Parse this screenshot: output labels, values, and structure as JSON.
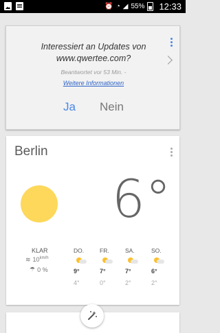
{
  "status_bar": {
    "battery": "55%",
    "time": "12:33"
  },
  "survey_card": {
    "question": "Interessiert an Updates von www.qwertee.com?",
    "meta": "Beantwortet vor 53 Min. -",
    "link": "Weitere Informationen",
    "yes_label": "Ja",
    "no_label": "Nein"
  },
  "weather_card": {
    "city": "Berlin",
    "temperature": "6°",
    "condition": "KLAR",
    "wind_value": "10",
    "wind_unit": "km/h",
    "precip": "0 %",
    "forecast": [
      {
        "day": "DO.",
        "high": "9°",
        "low": "4°"
      },
      {
        "day": "FR.",
        "high": "7°",
        "low": "0°"
      },
      {
        "day": "SA.",
        "high": "7°",
        "low": "2°"
      },
      {
        "day": "SO.",
        "high": "6°",
        "low": "2°"
      }
    ]
  },
  "colors": {
    "accent": "#4a86e8",
    "sun": "#fdd85a",
    "link": "#2d63c8"
  }
}
